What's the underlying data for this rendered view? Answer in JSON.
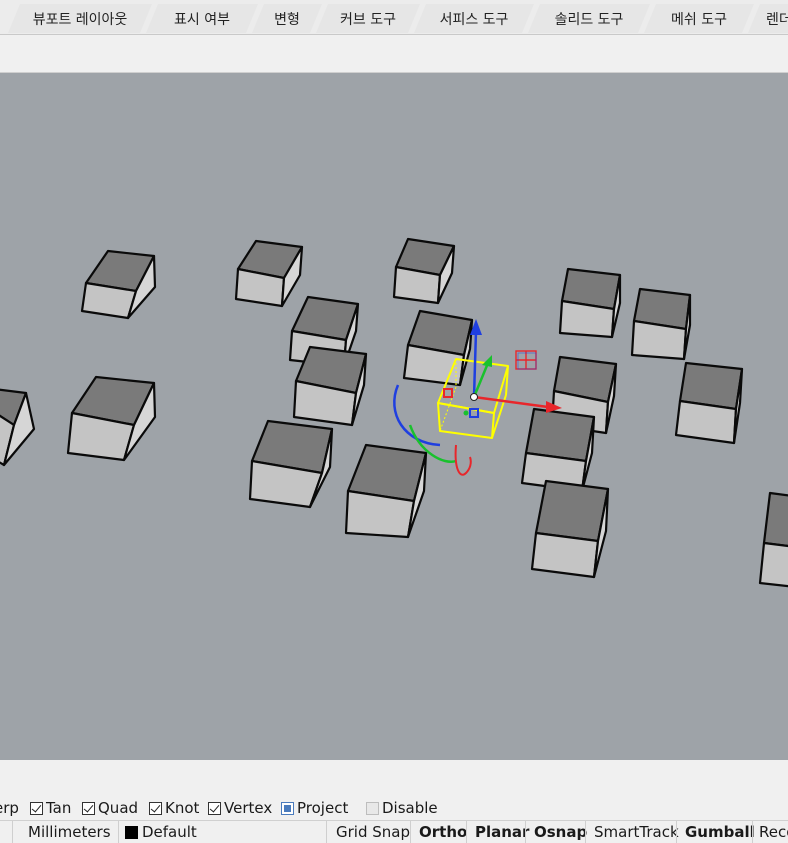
{
  "tabs": [
    {
      "label": "뷰포트 레이아웃"
    },
    {
      "label": "표시 여부"
    },
    {
      "label": "변형"
    },
    {
      "label": "커브 도구"
    },
    {
      "label": "서피스 도구"
    },
    {
      "label": "솔리드 도구"
    },
    {
      "label": "메쉬 도구"
    },
    {
      "label": "렌더"
    }
  ],
  "osnap": {
    "items": [
      {
        "label": "erp",
        "checked": true
      },
      {
        "label": "Tan",
        "checked": true
      },
      {
        "label": "Quad",
        "checked": true
      },
      {
        "label": "Knot",
        "checked": true
      },
      {
        "label": "Vertex",
        "checked": true
      },
      {
        "label": "Project",
        "state": "partial"
      },
      {
        "label": "Disable",
        "state": "disabled"
      }
    ]
  },
  "statusbar": {
    "units": "Millimeters",
    "layer": "Default",
    "layer_color": "#000000",
    "toggles": [
      {
        "label": "Grid Snap",
        "bold": false
      },
      {
        "label": "Ortho",
        "bold": true
      },
      {
        "label": "Planar",
        "bold": true
      },
      {
        "label": "Osnap",
        "bold": true
      },
      {
        "label": "SmartTrack",
        "bold": false
      },
      {
        "label": "Gumball",
        "bold": true
      },
      {
        "label": "Reco",
        "bold": false
      }
    ]
  },
  "viewport": {
    "background": "#9ea3a8",
    "selection_color": "#ffff00",
    "gumball_colors": {
      "x": "#e8262b",
      "y": "#19c12d",
      "z": "#1f3fe0"
    }
  }
}
